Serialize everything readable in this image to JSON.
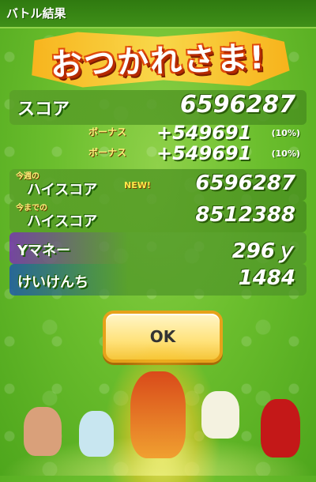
{
  "header": {
    "title": "バトル結果"
  },
  "banner": {
    "title": "おつかれさま!"
  },
  "results": {
    "score": {
      "label": "スコア",
      "value": "6596287"
    },
    "bonus1": {
      "label": "ボーナス",
      "value": "+549691",
      "pct": "(10%)"
    },
    "bonus2": {
      "label": "ボーナス",
      "value": "+549691",
      "pct": "(10%)"
    },
    "today_high": {
      "prefix": "今週の",
      "label": "ハイスコア",
      "badge": "NEW!",
      "value": "6596287"
    },
    "all_high": {
      "prefix": "今までの",
      "label": "ハイスコア",
      "value": "8512388"
    },
    "money": {
      "label": "Yマネー",
      "value": "296ｙ"
    },
    "exp": {
      "label": "けいけんち",
      "value": "1484"
    }
  },
  "ok_button": {
    "label": "OK"
  },
  "colors": {
    "accent": "#ffd84a",
    "background": "#6cbf2e",
    "money": "#7a32b4",
    "exp": "#1e5aaa"
  },
  "characters": [
    "old-man-character",
    "samurai-character",
    "red-haired-character",
    "white-dog-character",
    "red-bat-character"
  ]
}
